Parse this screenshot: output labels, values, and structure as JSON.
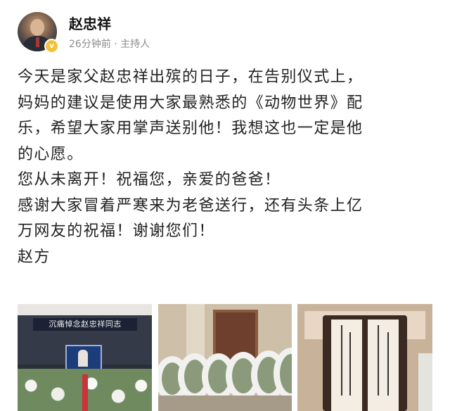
{
  "author": {
    "name": "赵忠祥",
    "meta": "26分钟前 · 主持人",
    "verified_badge_icon": "verified-badge-icon"
  },
  "post": {
    "paragraphs": [
      "今天是家父赵忠祥出殡的日子，在告别仪式上，",
      "妈妈的建议是使用大家最熟悉的《动物世界》配",
      "乐，希望大家用掌声送别他！我想这也一定是他",
      "的心愿。",
      "您从未离开！祝福您，亲爱的爸爸！",
      "感谢大家冒着严寒来为老爸送行，还有头条上亿",
      "万网友的祝福！谢谢您们！",
      "赵方"
    ]
  },
  "gallery": {
    "photo1_banner": "沉痛悼念赵忠祥同志"
  }
}
